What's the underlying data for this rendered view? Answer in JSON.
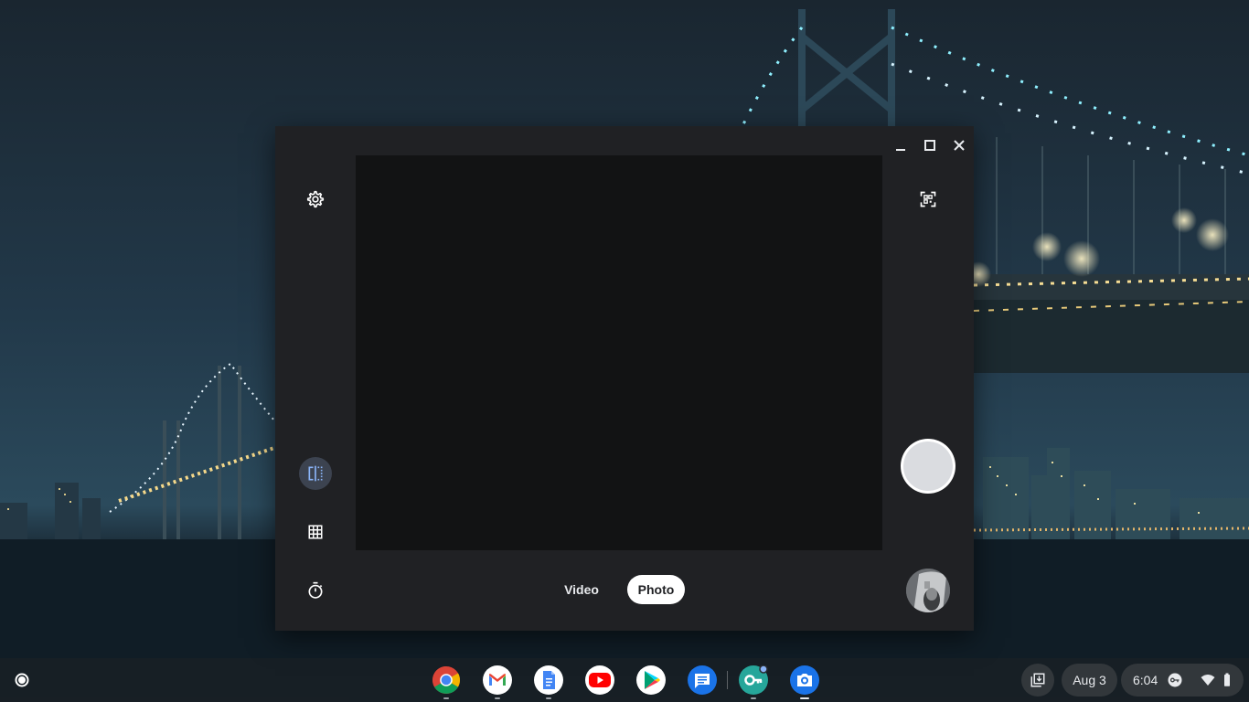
{
  "window": {
    "controls": {
      "minimize_icon": "minimize-icon",
      "maximize_icon": "maximize-icon",
      "close_icon": "close-icon"
    }
  },
  "camera": {
    "left_controls": [
      "settings-icon",
      "mirror-icon",
      "grid-icon",
      "timer-icon"
    ],
    "right_controls": [
      "qr-scan-icon",
      "shutter-button",
      "gallery-thumbnail"
    ],
    "modes": {
      "video": "Video",
      "photo": "Photo",
      "selected": "Photo"
    }
  },
  "shelf": {
    "apps": [
      "Chrome",
      "Gmail",
      "Docs",
      "YouTube",
      "Play Store",
      "Messages",
      "Keys app",
      "Camera"
    ],
    "date": "Aug 3",
    "time": "6:04"
  },
  "colors": {
    "window_bg": "#202124",
    "viewfinder_bg": "#121314",
    "active_control": "#3c4350",
    "accent_blue": "#8ab4f8"
  }
}
